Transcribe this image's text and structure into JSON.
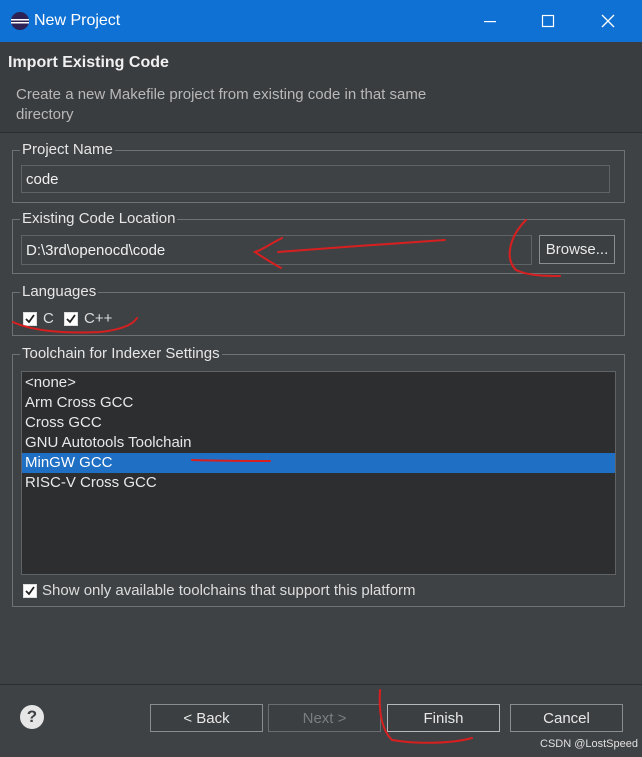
{
  "window": {
    "title": "New Project"
  },
  "header": {
    "title": "Import Existing Code",
    "description": "Create a new Makefile project from existing code in that same directory"
  },
  "project_name": {
    "label": "Project Name",
    "value": "code"
  },
  "location": {
    "label": "Existing Code Location",
    "value": "D:\\3rd\\openocd\\code",
    "browse_label": "Browse..."
  },
  "languages": {
    "label": "Languages",
    "items": [
      {
        "label": "C",
        "checked": true
      },
      {
        "label": "C++",
        "checked": true
      }
    ]
  },
  "toolchain": {
    "label": "Toolchain for Indexer Settings",
    "items": [
      "<none>",
      "Arm Cross GCC",
      "Cross GCC",
      "GNU Autotools Toolchain",
      "MinGW GCC",
      "RISC-V Cross GCC"
    ],
    "selected_index": 4,
    "filter_label": "Show only available toolchains that support this platform",
    "filter_checked": true
  },
  "buttons": {
    "back": "< Back",
    "next": "Next >",
    "finish": "Finish",
    "cancel": "Cancel"
  },
  "help_icon_label": "?",
  "watermark": "CSDN @LostSpeed",
  "colors": {
    "titlebar": "#0f71d3",
    "selection": "#1f6fc4",
    "annotation": "#d81f1f"
  }
}
